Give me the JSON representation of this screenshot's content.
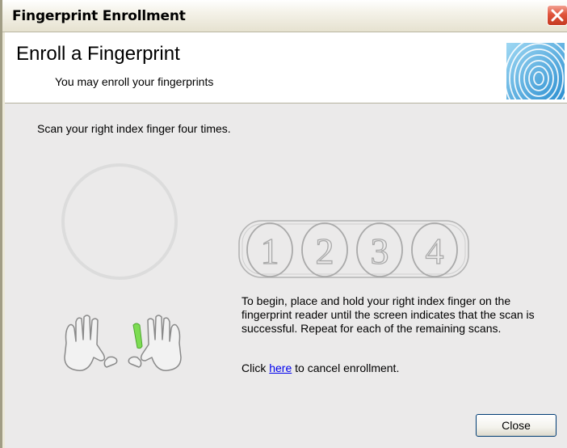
{
  "window": {
    "title": "Fingerprint Enrollment",
    "close_icon": "close-icon"
  },
  "header": {
    "title": "Enroll a Fingerprint",
    "subtitle": "You may enroll your fingerprints",
    "logo_icon": "fingerprint-icon"
  },
  "content": {
    "instruction": "Scan your right index finger four times.",
    "scan_steps": [
      "1",
      "2",
      "3",
      "4"
    ],
    "selected_finger": "right index",
    "body_text": "To begin, place and hold your right index finger on the fingerprint reader until the screen indicates that the scan is successful. Repeat for each of the remaining scans.",
    "cancel_prefix": "Click ",
    "cancel_link": "here",
    "cancel_suffix": " to cancel enrollment."
  },
  "buttons": {
    "close_label": "Close"
  },
  "colors": {
    "link": "#0000ee",
    "finger_highlight": "#7ddc52",
    "panel_bg": "#ebeaea",
    "close_button_red": "#e0543c"
  }
}
